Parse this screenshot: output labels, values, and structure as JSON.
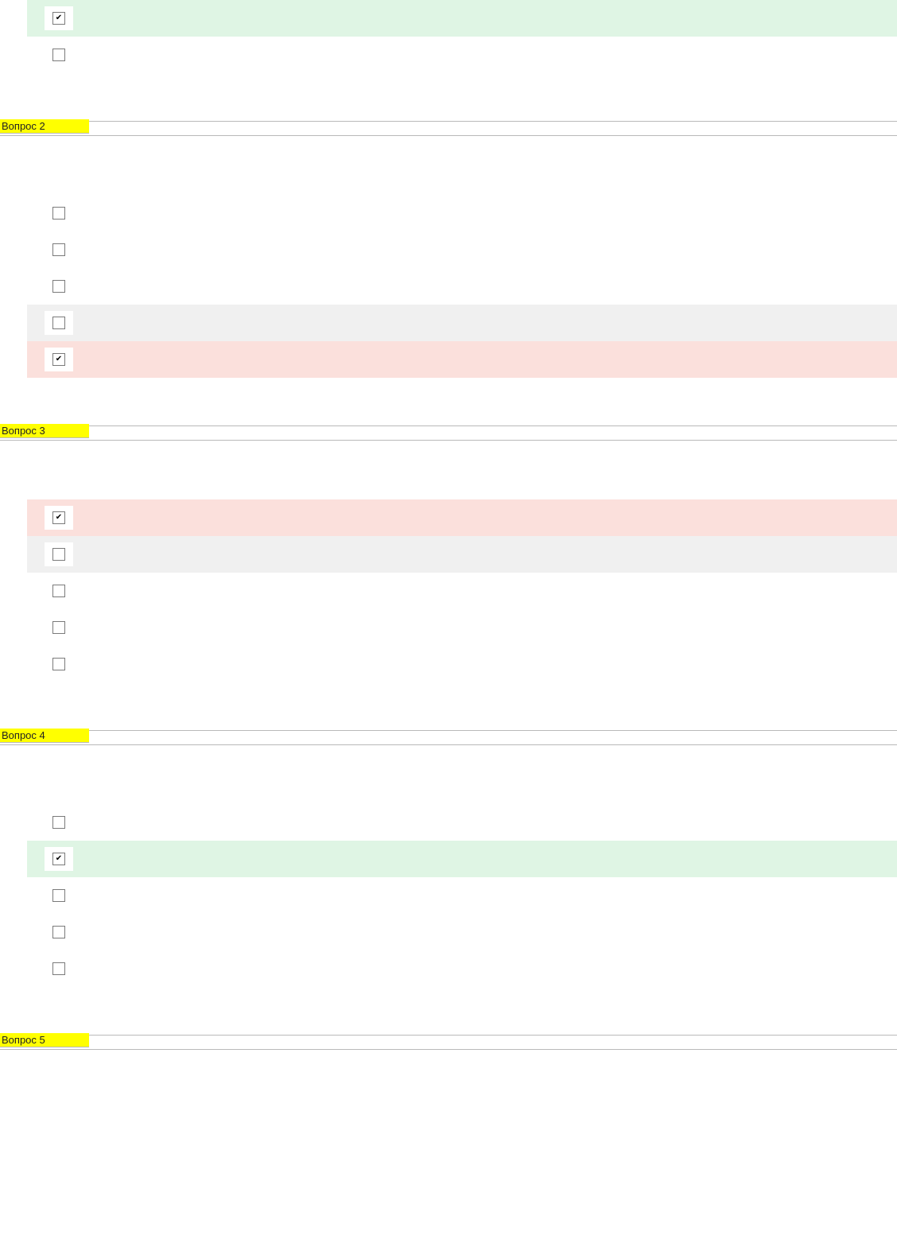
{
  "groups": [
    {
      "id": "partial-top",
      "header_label": "",
      "prompt": "",
      "options": [
        {
          "text": "",
          "checked": true,
          "state": "green"
        },
        {
          "text": "",
          "checked": false,
          "state": "none"
        }
      ]
    },
    {
      "id": "q-2",
      "header_label": "Вопрос 2",
      "prompt": "",
      "options": [
        {
          "text": "",
          "checked": false,
          "state": "none"
        },
        {
          "text": "",
          "checked": false,
          "state": "none"
        },
        {
          "text": "",
          "checked": false,
          "state": "none"
        },
        {
          "text": "",
          "checked": false,
          "state": "shade"
        },
        {
          "text": "",
          "checked": true,
          "state": "red"
        }
      ]
    },
    {
      "id": "q-3",
      "header_label": "Вопрос 3",
      "prompt": "",
      "options": [
        {
          "text": "",
          "checked": true,
          "state": "red"
        },
        {
          "text": "",
          "checked": false,
          "state": "shade"
        },
        {
          "text": "",
          "checked": false,
          "state": "none"
        },
        {
          "text": "",
          "checked": false,
          "state": "none"
        },
        {
          "text": "",
          "checked": false,
          "state": "none"
        }
      ]
    },
    {
      "id": "q-4",
      "header_label": "Вопрос 4",
      "prompt": "",
      "options": [
        {
          "text": "",
          "checked": false,
          "state": "none"
        },
        {
          "text": "",
          "checked": true,
          "state": "green"
        },
        {
          "text": "",
          "checked": false,
          "state": "none"
        },
        {
          "text": "",
          "checked": false,
          "state": "none"
        },
        {
          "text": "",
          "checked": false,
          "state": "none"
        }
      ]
    },
    {
      "id": "q-5",
      "header_label": "Вопрос 5",
      "prompt": "",
      "options": []
    }
  ],
  "colors": {
    "header_bg": "#ffff00",
    "correct_bg": "#dff5e4",
    "wrong_bg": "#fbe0dc",
    "shade_bg": "#f0f0f0",
    "rule": "#b9b9b9"
  }
}
